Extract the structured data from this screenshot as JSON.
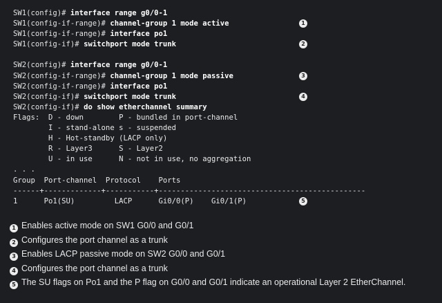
{
  "terminal": {
    "lines": [
      {
        "prompt": "SW1(config)# ",
        "command": "interface range g0/0-1",
        "badge": ""
      },
      {
        "prompt": "SW1(config-if-range)# ",
        "command": "channel-group 1 mode active",
        "badge": "1"
      },
      {
        "prompt": "SW1(config-if-range)# ",
        "command": "interface po1",
        "badge": ""
      },
      {
        "prompt": "SW1(config-if)# ",
        "command": "switchport mode trunk",
        "badge": "2"
      },
      {
        "prompt": "",
        "command": "",
        "badge": ""
      },
      {
        "prompt": "SW2(config)# ",
        "command": "interface range g0/0-1",
        "badge": ""
      },
      {
        "prompt": "SW2(config-if-range)# ",
        "command": "channel-group 1 mode passive",
        "badge": "3"
      },
      {
        "prompt": "SW2(config-if-range)# ",
        "command": "interface po1",
        "badge": ""
      },
      {
        "prompt": "SW2(config-if)# ",
        "command": "switchport mode trunk",
        "badge": "4"
      },
      {
        "prompt": "SW2(config-if)# ",
        "command": "do show etherchannel summary",
        "badge": ""
      },
      {
        "prompt": "Flags:  D - down        P - bundled in port-channel",
        "command": "",
        "badge": ""
      },
      {
        "prompt": "        I - stand-alone s - suspended",
        "command": "",
        "badge": ""
      },
      {
        "prompt": "        H - Hot-standby (LACP only)",
        "command": "",
        "badge": ""
      },
      {
        "prompt": "        R - Layer3      S - Layer2",
        "command": "",
        "badge": ""
      },
      {
        "prompt": "        U - in use      N - not in use, no aggregation",
        "command": "",
        "badge": ""
      },
      {
        "prompt": ". . .",
        "command": "",
        "badge": ""
      },
      {
        "prompt": "Group  Port-channel  Protocol    Ports",
        "command": "",
        "badge": ""
      },
      {
        "prompt": "------+-------------+-----------+-----------------------------------------------",
        "command": "",
        "badge": ""
      },
      {
        "prompt": "1      Po1(SU)         LACP      Gi0/0(P)    Gi0/1(P)",
        "command": "",
        "badge": "5"
      }
    ]
  },
  "notes": [
    {
      "badge": "1",
      "text": "Enables active mode on SW1 G0/0 and G0/1"
    },
    {
      "badge": "2",
      "text": "Configures the port channel as a trunk"
    },
    {
      "badge": "3",
      "text": "Enables LACP passive mode on SW2 G0/0 and G0/1"
    },
    {
      "badge": "4",
      "text": "Configures the port channel as a trunk"
    },
    {
      "badge": "5",
      "text": "The SU flags on Po1 and the P flag on G0/0 and G0/1 indicate an operational Layer 2 EtherChannel."
    }
  ]
}
